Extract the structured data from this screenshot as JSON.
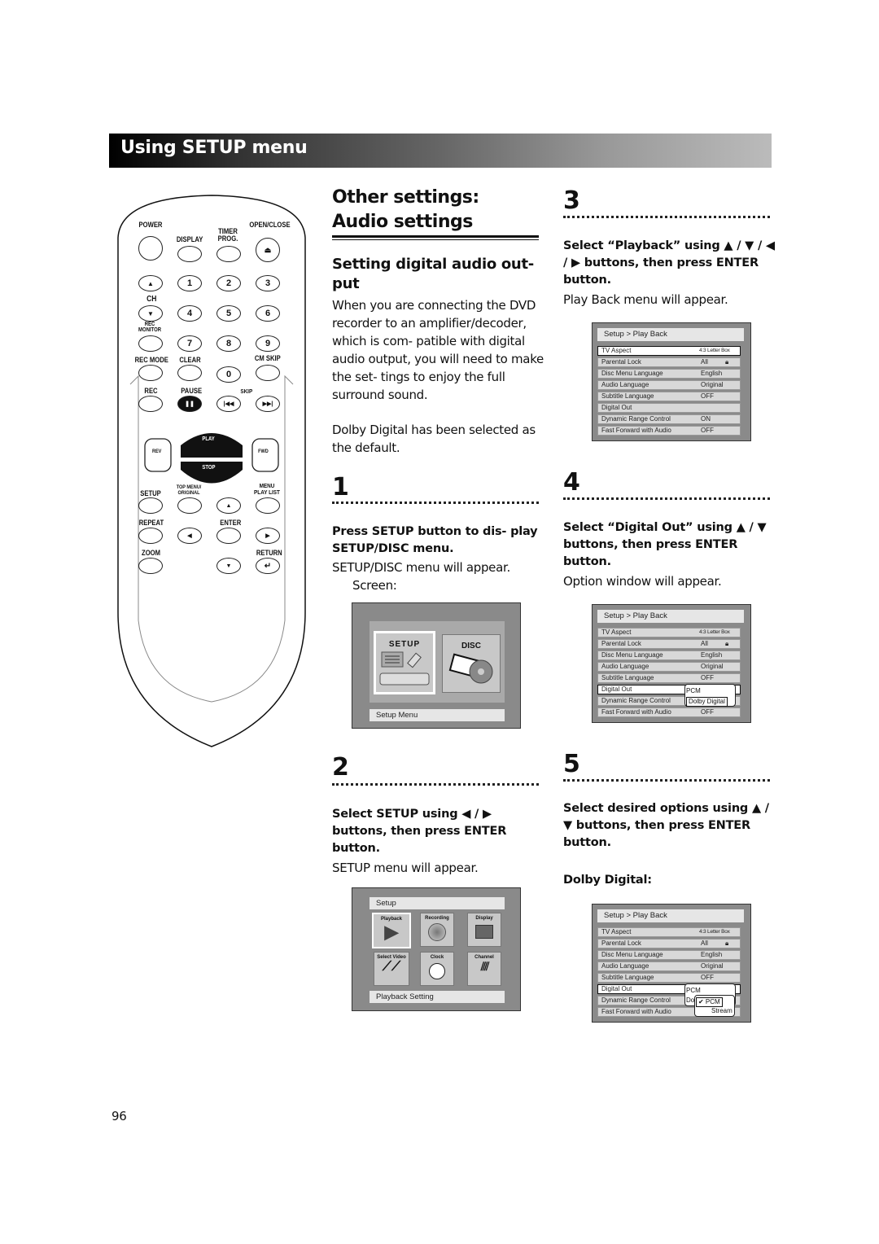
{
  "header": {
    "title": "Using SETUP menu"
  },
  "remote": {
    "labels": {
      "power": "POWER",
      "display": "DISPLAY",
      "timer_prog": "TIMER PROG.",
      "open_close": "OPEN/CLOSE",
      "ch": "CH",
      "rec_monitor": "REC MONITOR",
      "rec_mode": "REC MODE",
      "clear": "CLEAR",
      "cm_skip": "CM SKIP",
      "rec": "REC",
      "pause": "PAUSE",
      "skip": "SKIP",
      "play": "PLAY",
      "stop": "STOP",
      "rev": "REV",
      "fwd": "FWD",
      "setup": "SETUP",
      "top_menu": "TOP MENU/ ORIGINAL",
      "menu": "MENU PLAY LIST",
      "repeat": "REPEAT",
      "enter": "ENTER",
      "zoom": "ZOOM",
      "return": "RETURN"
    },
    "digits": [
      "1",
      "2",
      "3",
      "4",
      "5",
      "6",
      "7",
      "8",
      "9",
      "0"
    ]
  },
  "intro": {
    "title_line1": "Other settings:",
    "title_line2": "Audio settings",
    "subtitle": "Setting digital audio out- put",
    "paragraph1": "When you are connecting the DVD recorder to an amplifier/decoder, which is com- patible with digital audio output, you will need to make the set- tings to enjoy the full surround sound.",
    "paragraph2": "Dolby Digital has been selected as the default."
  },
  "steps": [
    {
      "num": "1",
      "heading": "Press SETUP button to dis- play SETUP/DISC menu.",
      "body": "SETUP/DISC menu will appear.",
      "extra": "Screen:"
    },
    {
      "num": "2",
      "heading": "Select SETUP using ◀ / ▶ buttons, then press ENTER button.",
      "body": "SETUP menu will appear."
    },
    {
      "num": "3",
      "heading": "Select “Playback” using ▲ / ▼ / ◀ / ▶ buttons, then press ENTER button.",
      "body": "Play Back menu will appear."
    },
    {
      "num": "4",
      "heading": "Select “Digital Out” using ▲ / ▼ buttons, then press ENTER button.",
      "body": "Option window will appear."
    },
    {
      "num": "5",
      "heading": "Select desired options using ▲ / ▼ buttons, then press ENTER button.",
      "sublabel": "Dolby Digital:"
    }
  ],
  "screen_setup_disc": {
    "tile_setup": "SETUP",
    "tile_disc": "DISC",
    "footer": "Setup Menu"
  },
  "screen_setup": {
    "title": "Setup",
    "tiles": [
      "Playback",
      "Recording",
      "Display",
      "Select Video",
      "Clock",
      "Channel"
    ],
    "footer": "Playback Setting"
  },
  "screen_playback": {
    "title": "Setup > Play Back",
    "rows": [
      {
        "label": "TV Aspect",
        "value": "4:3 Letter Box"
      },
      {
        "label": "Parental Lock",
        "value": "All"
      },
      {
        "label": "Disc Menu Language",
        "value": "English"
      },
      {
        "label": "Audio Language",
        "value": "Original"
      },
      {
        "label": "Subtitle Language",
        "value": "OFF"
      },
      {
        "label": "Digital Out",
        "value": ""
      },
      {
        "label": "Dynamic Range Control",
        "value": "ON"
      },
      {
        "label": "Fast Forward with Audio",
        "value": "OFF"
      }
    ],
    "popup_options": [
      "PCM",
      "Dolby Digital"
    ],
    "sub_popup_options": [
      "✔ PCM",
      "Stream"
    ],
    "partial_label": "Do"
  },
  "page_number": "96"
}
